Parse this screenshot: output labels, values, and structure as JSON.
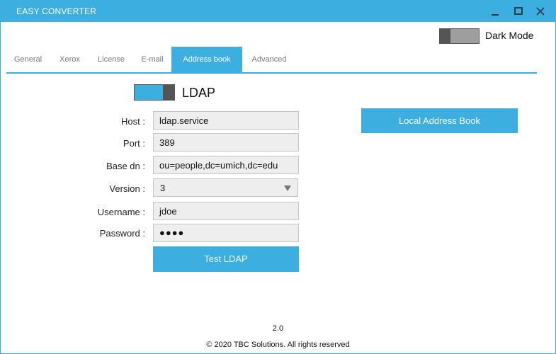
{
  "window": {
    "title": "EASY CONVERTER",
    "controls": {
      "minimize": "minimize-icon",
      "maximize": "maximize-icon",
      "close": "close-icon"
    },
    "accent_color": "#3daee0"
  },
  "dark_mode": {
    "label": "Dark Mode",
    "enabled": false
  },
  "tabs": [
    {
      "label": "General",
      "active": false
    },
    {
      "label": "Xerox",
      "active": false
    },
    {
      "label": "License",
      "active": false
    },
    {
      "label": "E-mail",
      "active": false
    },
    {
      "label": "Address book",
      "active": true
    },
    {
      "label": "Advanced",
      "active": false
    }
  ],
  "ldap": {
    "label": "LDAP",
    "enabled": true,
    "fields": {
      "host": {
        "label": "Host :",
        "value": "ldap.service"
      },
      "port": {
        "label": "Port :",
        "value": "389"
      },
      "base_dn": {
        "label": "Base dn :",
        "value": "ou=people,dc=umich,dc=edu"
      },
      "version": {
        "label": "Version :",
        "value": "3"
      },
      "username": {
        "label": "Username :",
        "value": "jdoe"
      },
      "password": {
        "label": "Password :",
        "value": "●●●●"
      }
    },
    "test_button": "Test LDAP"
  },
  "local_address_book_button": "Local Address Book",
  "footer": {
    "version": "2.0",
    "copyright": "© 2020 TBC Solutions. All rights reserved"
  }
}
